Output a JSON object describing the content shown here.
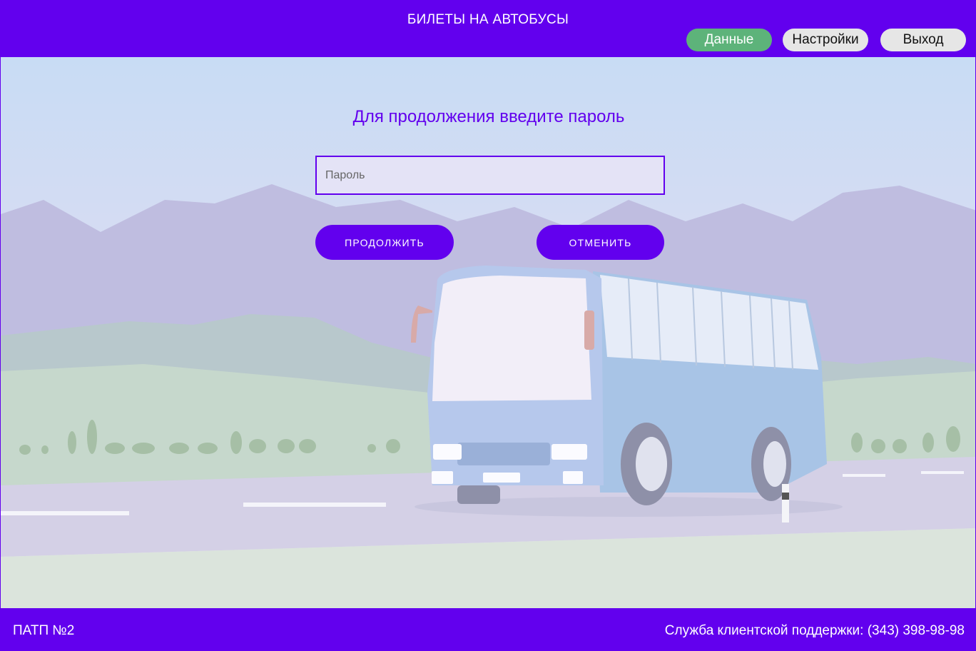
{
  "header": {
    "title": "БИЛЕТЫ НА АВТОБУСЫ",
    "nav": {
      "data_label": "Данные",
      "settings_label": "Настройки",
      "exit_label": "Выход"
    }
  },
  "main": {
    "prompt": "Для продолжения введите пароль",
    "password": {
      "placeholder": "Пароль",
      "value": ""
    },
    "continue_label": "ПРОДОЛЖИТЬ",
    "cancel_label": "ОТМЕНИТЬ"
  },
  "footer": {
    "org": "ПАТП №2",
    "support": "Служба клиентской поддержки: (343) 398-98-98"
  },
  "colors": {
    "primary": "#6200EE",
    "data_button": "#5DB37A",
    "secondary_button": "#E6E6E6"
  }
}
